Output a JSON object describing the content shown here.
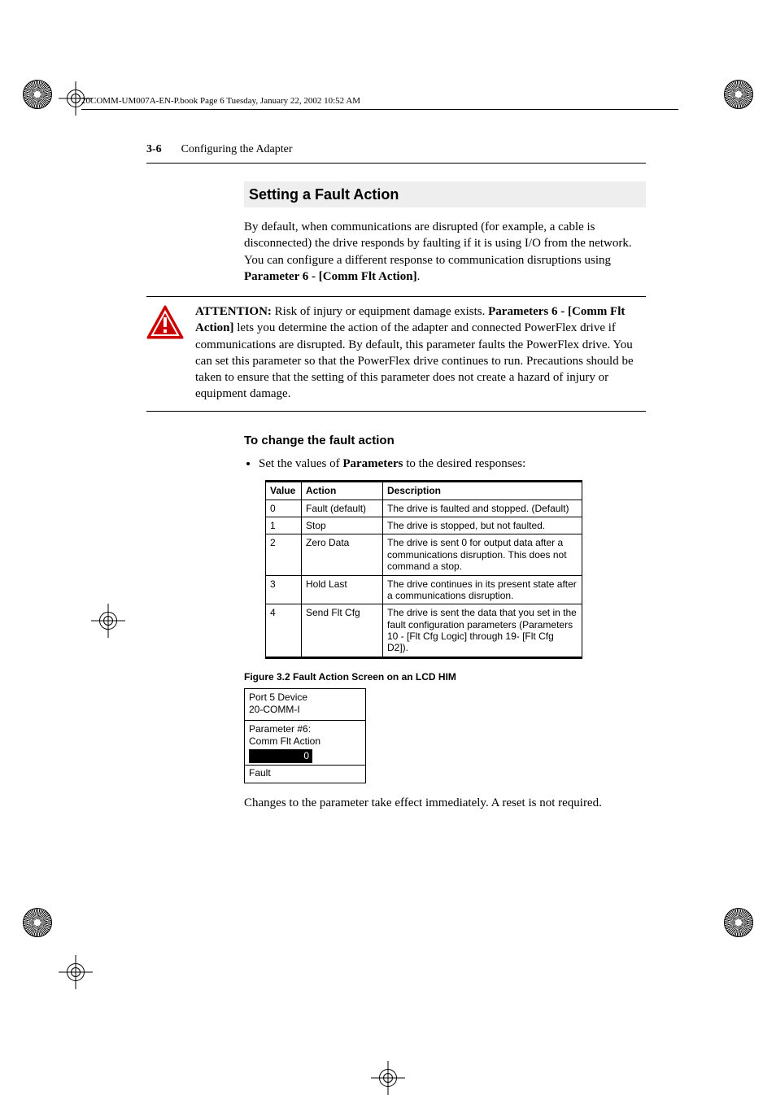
{
  "book_header": "20COMM-UM007A-EN-P.book  Page 6  Tuesday, January 22, 2002  10:52 AM",
  "page_number": "3-6",
  "chapter_title": "Configuring the Adapter",
  "section_title": "Setting a Fault Action",
  "intro_paragraph": "By default, when communications are disrupted (for example, a cable is disconnected) the drive responds by faulting if it is using I/O from the network. You can configure a different response to communication disruptions using ",
  "intro_param_bold": "Parameter 6 - [Comm Flt Action]",
  "intro_period": ".",
  "attention": {
    "lead": "ATTENTION:",
    "lead_rest": "  Risk of injury or equipment damage exists. ",
    "bold2": "Parameters 6 - [Comm Flt Action]",
    "rest": " lets you determine the action of the adapter and connected PowerFlex drive if communications are disrupted. By default, this parameter faults the PowerFlex drive. You can set this parameter so that the PowerFlex drive continues to run. Precautions should be taken to ensure that the setting of this parameter does not create a hazard of injury or equipment damage."
  },
  "subheading": "To change the fault action",
  "bullet_prefix": "Set the values of ",
  "bullet_bold": "Parameters",
  "bullet_suffix": " to the desired responses:",
  "table": {
    "headers": {
      "value": "Value",
      "action": "Action",
      "description": "Description"
    },
    "rows": [
      {
        "value": "0",
        "action": "Fault (default)",
        "description": "The drive is faulted and stopped. (Default)"
      },
      {
        "value": "1",
        "action": "Stop",
        "description": "The drive is stopped, but not faulted."
      },
      {
        "value": "2",
        "action": "Zero Data",
        "description": "The drive is sent 0 for output data after a communications disruption. This does not command a stop."
      },
      {
        "value": "3",
        "action": "Hold Last",
        "description": "The drive continues in its present state after a communications disruption."
      },
      {
        "value": "4",
        "action": "Send Flt Cfg",
        "description": "The drive is sent the data that you set in the fault configuration parameters (Parameters 10 - [Flt Cfg Logic] through 19- [Flt Cfg D2])."
      }
    ]
  },
  "figure_caption": "Figure 3.2   Fault Action Screen on an LCD HIM",
  "him": {
    "line1": "Port 5 Device",
    "line2": "20-COMM-I",
    "param_line1": "Parameter #6:",
    "param_line2": "Comm Flt Action",
    "value": "0",
    "status": "Fault"
  },
  "closing": "Changes to the parameter take effect immediately. A reset is not required."
}
